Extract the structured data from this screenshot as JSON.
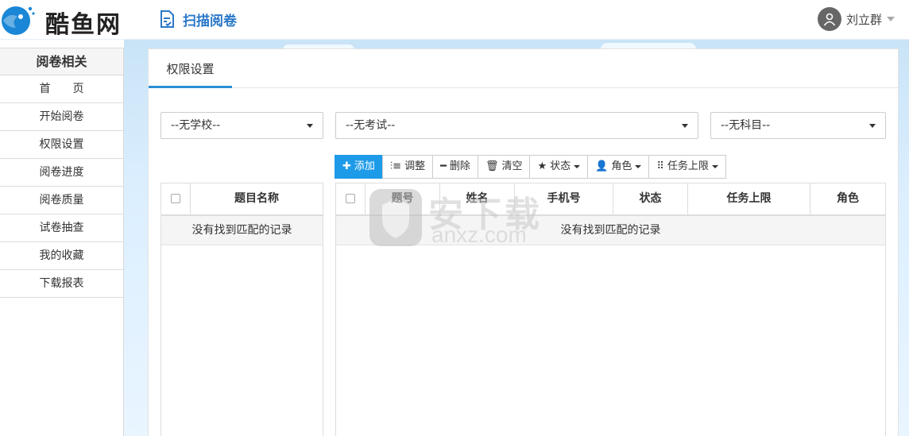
{
  "app": {
    "logo_text": "酷鱼网",
    "nav_title": "扫描阅卷"
  },
  "user": {
    "name": "刘立群"
  },
  "sidebar": {
    "title": "阅卷相关",
    "items": [
      {
        "label": "首页"
      },
      {
        "label": "开始阅卷"
      },
      {
        "label": "权限设置"
      },
      {
        "label": "阅卷进度"
      },
      {
        "label": "阅卷质量"
      },
      {
        "label": "试卷抽查"
      },
      {
        "label": "我的收藏"
      },
      {
        "label": "下载报表"
      }
    ]
  },
  "main": {
    "tab_label": "权限设置",
    "filters": {
      "school": "--无学校--",
      "exam": "--无考试--",
      "subject": "--无科目--"
    },
    "toolbar": {
      "add": "添加",
      "adjust": "调整",
      "delete": "删除",
      "clear": "清空",
      "status": "状态",
      "role": "角色",
      "task_limit": "任务上限"
    },
    "left_table": {
      "headers": [
        "题目名称"
      ],
      "empty_text": "没有找到匹配的记录"
    },
    "right_table": {
      "headers": [
        "题号",
        "姓名",
        "手机号",
        "状态",
        "任务上限",
        "角色"
      ],
      "empty_text": "没有找到匹配的记录"
    }
  },
  "watermark": {
    "text": "安下载",
    "url": "anxz.com"
  },
  "colors": {
    "primary": "#1e9be8",
    "nav": "#2a78c8",
    "tab_accent": "#2a8fd6"
  }
}
